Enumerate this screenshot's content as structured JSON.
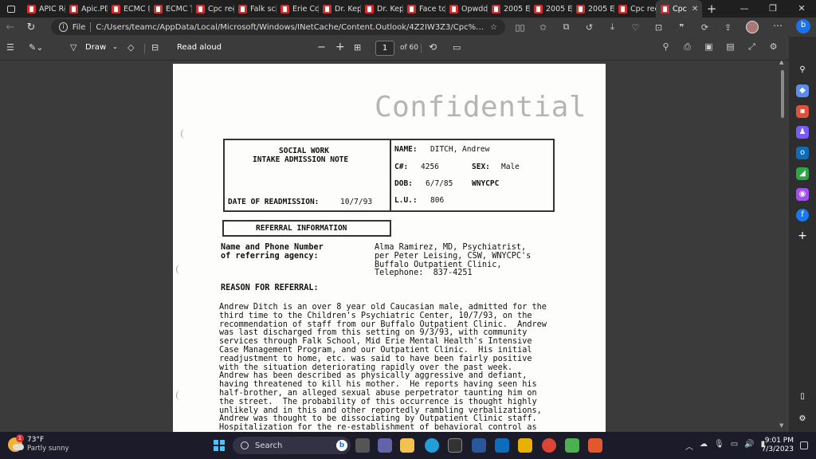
{
  "browser": {
    "tabs": [
      {
        "label": "APIC Re"
      },
      {
        "label": "Apic.PD"
      },
      {
        "label": "ECMC R"
      },
      {
        "label": "ECMC T"
      },
      {
        "label": "Cpc rec"
      },
      {
        "label": "Falk sch"
      },
      {
        "label": "Erie Co"
      },
      {
        "label": "Dr. Kep"
      },
      {
        "label": "Dr. Kep"
      },
      {
        "label": "Face to"
      },
      {
        "label": "Opwdd"
      },
      {
        "label": "2005 Ed"
      },
      {
        "label": "2005 Ed"
      },
      {
        "label": "2005 Ed"
      },
      {
        "label": "Cpc rec"
      },
      {
        "label": "Cpc"
      }
    ],
    "new_tab": "+",
    "address": {
      "scheme_label": "File",
      "url": "C:/Users/teamc/AppData/Local/Microsoft/Windows/INetCache/Content.Outlook/4Z2IW3Z3/Cpc%20November%..."
    }
  },
  "pdf_toolbar": {
    "draw_label": "Draw",
    "read_aloud_label": "Read aloud",
    "page_number": "1",
    "page_count": "of 60"
  },
  "document": {
    "watermark": "Confidential",
    "header": {
      "title_line1": "SOCIAL WORK",
      "title_line2": "INTAKE ADMISSION NOTE",
      "readmission_label": "DATE OF READMISSION:",
      "readmission_value": "10/7/93",
      "name_label": "NAME:",
      "name_value": "DITCH, Andrew",
      "cnum_label": "C#:",
      "cnum_value": "4256",
      "sex_label": "SEX:",
      "sex_value": "Male",
      "dob_label": "DOB:",
      "dob_value": "6/7/85",
      "facility": "WNYCPC",
      "lu_label": "L.U.:",
      "lu_value": "806"
    },
    "referral_heading": "REFERRAL INFORMATION",
    "agency_label": "Name and Phone Number\nof referring agency:",
    "agency_value": "Alma Ramirez, MD, Psychiatrist,\nper Peter Leising, CSW, WNYCPC's\nBuffalo Outpatient Clinic,\nTelephone:  837-4251",
    "reason_heading": "REASON FOR REFERRAL:",
    "reason_body": "Andrew Ditch is an over 8 year old Caucasian male, admitted for the\nthird time to the Children's Psychiatric Center, 10/7/93, on the\nrecommendation of staff from our Buffalo Outpatient Clinic.  Andrew\nwas last discharged from this setting on 9/3/93, with community\nservices through Falk School, Mid Erie Mental Health's Intensive\nCase Management Program, and our Outpatient Clinic.  His initial\nreadjustment to home, etc. was said to have been fairly positive\nwith the situation deteriorating rapidly over the past week.\nAndrew has been described as physically aggressive and defiant,\nhaving threatened to kill his mother.  He reports having seen his\nhalf-brother, an alleged sexual abuse perpetrator taunting him on\nthe street.  The probability of this occurrence is thought highly\nunlikely and in this and other reportedly rambling verbalizations,\nAndrew was thought to be dissociating by Outpatient Clinic staff.\nHospitalization for the re-establishment of behavioral control as\nwell as possible neuroleptic medication"
  },
  "taskbar": {
    "temperature": "73°F",
    "condition": "Partly sunny",
    "weather_badge": "1",
    "search_label": "Search",
    "time": "9:01 PM",
    "date": "7/3/2023"
  },
  "colors": {
    "pdf_tab_icon": "#d32f2f",
    "taskbar_bg": "#1c1b2a",
    "windows_accent": "#4cc2ff"
  }
}
